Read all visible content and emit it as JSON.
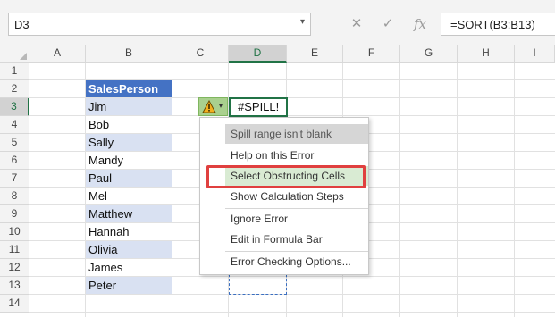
{
  "formula_bar": {
    "name_box": "D3",
    "name_box_arrow": "▾",
    "cancel_icon": "✕",
    "enter_icon": "✓",
    "fx_label": "fx",
    "formula": "=SORT(B3:B13)"
  },
  "columns": [
    "A",
    "B",
    "C",
    "D",
    "E",
    "F",
    "G",
    "H",
    "I"
  ],
  "rows": [
    "1",
    "2",
    "3",
    "4",
    "5",
    "6",
    "7",
    "8",
    "9",
    "10",
    "11",
    "12",
    "13",
    "14"
  ],
  "table": {
    "header": "SalesPerson",
    "names": [
      "Jim",
      "Bob",
      "Sally",
      "Mandy",
      "Paul",
      "Mel",
      "Matthew",
      "Hannah",
      "Olivia",
      "James",
      "Peter"
    ]
  },
  "spill_cell": {
    "value": "#SPILL!"
  },
  "error_button": {
    "icon": "warning-icon",
    "arrow": "▾"
  },
  "context_menu": {
    "title": "Spill range isn't blank",
    "items": [
      "Help on this Error",
      "Select Obstructing Cells",
      "Show Calculation Steps",
      "Ignore Error",
      "Edit in Formula Bar",
      "Error Checking Options..."
    ],
    "highlighted_item": "Select Obstructing Cells"
  },
  "colors": {
    "table_header": "#4472c4",
    "band": "#d9e1f2",
    "excel_green": "#217346",
    "highlight_box": "#e0403f"
  }
}
